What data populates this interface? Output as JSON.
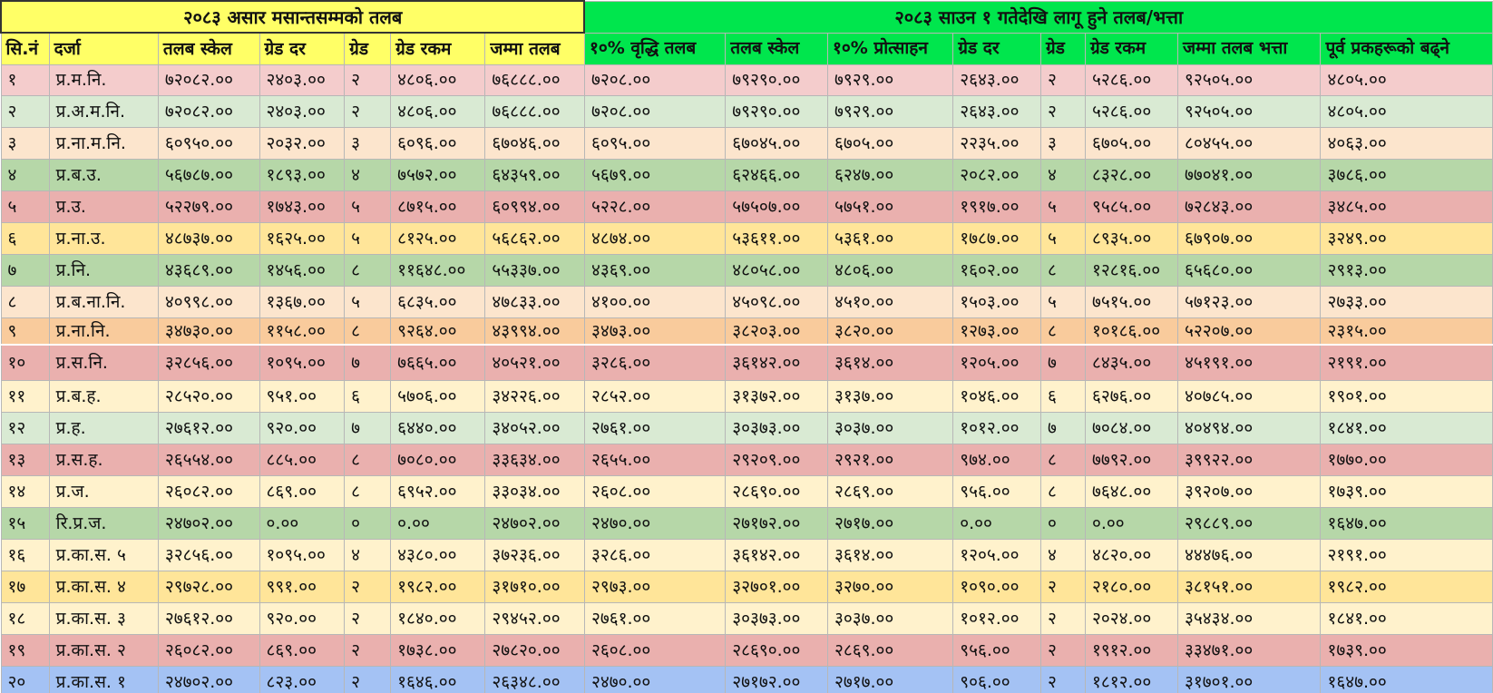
{
  "colors": {
    "yellow": "#ffff66",
    "green": "#00e64d",
    "pink": "#f4cccc",
    "light_green": "#d9ead3",
    "peach": "#fce5cd",
    "mid_green": "#b6d7a8",
    "rose": "#eab0ae",
    "gold": "#ffe599",
    "orange": "#f9cb9c",
    "cream": "#fff2cc",
    "blue": "#a4c2f4"
  },
  "header": {
    "left_title": "२०८३ असार मसान्तसम्मको तलब",
    "right_title": "२०८३ साउन १ गतेदेखि लागू हुने तलब/भत्ता"
  },
  "columns": [
    "सि.नं",
    "दर्जा",
    "तलब स्केल",
    "ग्रेड दर",
    "ग्रेड",
    "ग्रेड रकम",
    "जम्मा तलब",
    "१०% वृद्धि तलब",
    "तलब स्केल",
    "१०% प्रोत्साहन",
    "ग्रेड दर",
    "ग्रेड",
    "ग्रेड रकम",
    "जम्मा तलब भत्ता",
    "पूर्व प्रकहरूको बढ्ने"
  ],
  "rows": [
    {
      "color": "pink",
      "cells": [
        "१",
        "प्र.म.नि.",
        "७२०८२.००",
        "२४०३.००",
        "२",
        "४८०६.००",
        "७६८८८.००",
        "७२०८.००",
        "७९२९०.००",
        "७९२९.००",
        "२६४३.००",
        "२",
        "५२८६.००",
        "९२५०५.००",
        "४८०५.००"
      ]
    },
    {
      "color": "light_green",
      "cells": [
        "२",
        "प्र.अ.म.नि.",
        "७२०८२.००",
        "२४०३.००",
        "२",
        "४८०६.००",
        "७६८८८.००",
        "७२०८.००",
        "७९२९०.००",
        "७९२९.००",
        "२६४३.००",
        "२",
        "५२८६.००",
        "९२५०५.००",
        "४८०५.००"
      ]
    },
    {
      "color": "peach",
      "cells": [
        "३",
        "प्र.ना.म.नि.",
        "६०९५०.००",
        "२०३२.००",
        "३",
        "६०९६.००",
        "६७०४६.००",
        "६०९५.००",
        "६७०४५.००",
        "६७०५.००",
        "२२३५.००",
        "३",
        "६७०५.००",
        "८०४५५.००",
        "४०६३.००"
      ]
    },
    {
      "color": "mid_green",
      "cells": [
        "४",
        "प्र.ब.उ.",
        "५६७८७.००",
        "१८९३.००",
        "४",
        "७५७२.००",
        "६४३५९.००",
        "५६७९.००",
        "६२४६६.००",
        "६२४७.००",
        "२०८२.००",
        "४",
        "८३२८.००",
        "७७०४१.००",
        "३७८६.००"
      ]
    },
    {
      "color": "rose",
      "cells": [
        "५",
        "प्र.उ.",
        "५२२७९.००",
        "१७४३.००",
        "५",
        "८७१५.००",
        "६०९९४.००",
        "५२२८.००",
        "५७५०७.००",
        "५७५१.००",
        "१९१७.००",
        "५",
        "९५८५.००",
        "७२८४३.००",
        "३४८५.००"
      ]
    },
    {
      "color": "gold",
      "cells": [
        "६",
        "प्र.ना.उ.",
        "४८७३७.००",
        "१६२५.००",
        "५",
        "८१२५.००",
        "५६८६२.००",
        "४८७४.००",
        "५३६११.००",
        "५३६१.००",
        "१७८७.००",
        "५",
        "८९३५.००",
        "६७९०७.००",
        "३२४९.००"
      ]
    },
    {
      "color": "mid_green",
      "cells": [
        "७",
        "प्र.नि.",
        "४३६८९.००",
        "१४५६.००",
        "८",
        "११६४८.००",
        "५५३३७.००",
        "४३६९.००",
        "४८०५८.००",
        "४८०६.००",
        "१६०२.००",
        "८",
        "१२८१६.००",
        "६५६८०.००",
        "२९१३.००"
      ]
    },
    {
      "color": "peach",
      "cells": [
        "८",
        "प्र.ब.ना.नि.",
        "४०९९८.००",
        "१३६७.००",
        "५",
        "६८३५.००",
        "४७८३३.००",
        "४१००.००",
        "४५०९८.००",
        "४५१०.००",
        "१५०३.००",
        "५",
        "७५१५.००",
        "५७१२३.००",
        "२७३३.००"
      ]
    },
    {
      "color": "orange",
      "cells": [
        "९",
        "प्र.ना.नि.",
        "३४७३०.००",
        "११५८.००",
        "८",
        "९२६४.००",
        "४३९९४.००",
        "३४७३.००",
        "३८२०३.००",
        "३८२०.००",
        "१२७३.००",
        "८",
        "१०१८६.००",
        "५२२०७.००",
        "२३१५.००"
      ]
    },
    {
      "color": "rose",
      "cells": [
        "१०",
        "प्र.स.नि.",
        "३२८५६.००",
        "१०९५.००",
        "७",
        "७६६५.००",
        "४०५२१.००",
        "३२८६.००",
        "३६१४२.००",
        "३६१४.००",
        "१२०५.००",
        "७",
        "८४३५.००",
        "४५१९१.००",
        "२१९१.००"
      ]
    },
    {
      "color": "cream",
      "cells": [
        "११",
        "प्र.ब.ह.",
        "२८५२०.००",
        "९५१.००",
        "६",
        "५७०६.००",
        "३४२२६.००",
        "२८५२.००",
        "३१३७२.००",
        "३१३७.००",
        "१०४६.००",
        "६",
        "६२७६.००",
        "४०७८५.००",
        "१९०१.००"
      ]
    },
    {
      "color": "light_green",
      "cells": [
        "१२",
        "प्र.ह.",
        "२७६१२.००",
        "९२०.००",
        "७",
        "६४४०.००",
        "३४०५२.००",
        "२७६१.००",
        "३०३७३.००",
        "३०३७.००",
        "१०१२.००",
        "७",
        "७०८४.००",
        "४०४९४.००",
        "१८४१.००"
      ]
    },
    {
      "color": "rose",
      "cells": [
        "१३",
        "प्र.स.ह.",
        "२६५५४.००",
        "८८५.००",
        "८",
        "७०८०.००",
        "३३६३४.००",
        "२६५५.००",
        "२९२०९.००",
        "२९२१.००",
        "९७४.००",
        "८",
        "७७९२.००",
        "३९९२२.००",
        "१७७०.००"
      ]
    },
    {
      "color": "cream",
      "cells": [
        "१४",
        "प्र.ज.",
        "२६०८२.००",
        "८६९.००",
        "८",
        "६९५२.००",
        "३३०३४.००",
        "२६०८.००",
        "२८६९०.००",
        "२८६९.००",
        "९५६.००",
        "८",
        "७६४८.००",
        "३९२०७.००",
        "१७३९.००"
      ]
    },
    {
      "color": "mid_green",
      "cells": [
        "१५",
        "रि.प्र.ज.",
        "२४७०२.००",
        "०.००",
        "०",
        "०.००",
        "२४७०२.००",
        "२४७०.००",
        "२७१७२.००",
        "२७१७.००",
        "०.००",
        "०",
        "०.००",
        "२९८८९.००",
        "१६४७.००"
      ]
    },
    {
      "color": "cream",
      "cells": [
        "१६",
        "प्र.का.स. ५",
        "३२८५६.००",
        "१०९५.००",
        "४",
        "४३८०.००",
        "३७२३६.००",
        "३२८६.००",
        "३६१४२.००",
        "३६१४.००",
        "१२०५.००",
        "४",
        "४८२०.००",
        "४४४७६.००",
        "२१९१.००"
      ]
    },
    {
      "color": "gold",
      "cells": [
        "१७",
        "प्र.का.स. ४",
        "२९७२८.००",
        "९९१.००",
        "२",
        "१९८२.००",
        "३१७१०.००",
        "२९७३.००",
        "३२७०१.००",
        "३२७०.००",
        "१०९०.००",
        "२",
        "२१८०.००",
        "३८१५१.००",
        "१९८२.००"
      ]
    },
    {
      "color": "cream",
      "cells": [
        "१८",
        "प्र.का.स. ३",
        "२७६१२.००",
        "९२०.००",
        "२",
        "१८४०.००",
        "२९४५२.००",
        "२७६१.००",
        "३०३७३.००",
        "३०३७.००",
        "१०१२.००",
        "२",
        "२०२४.००",
        "३५४३४.००",
        "१८४१.००"
      ]
    },
    {
      "color": "rose",
      "cells": [
        "१९",
        "प्र.का.स. २",
        "२६०८२.००",
        "८६९.००",
        "२",
        "१७३८.००",
        "२७८२०.००",
        "२६०८.००",
        "२८६९०.००",
        "२८६९.००",
        "९५६.००",
        "२",
        "१९१२.००",
        "३३४७१.००",
        "१७३९.००"
      ]
    },
    {
      "color": "blue",
      "cells": [
        "२०",
        "प्र.का.स. १",
        "२४७०२.००",
        "८२३.००",
        "२",
        "१६४६.००",
        "२६३४८.००",
        "२४७०.००",
        "२७१७२.००",
        "२७१७.००",
        "९०६.००",
        "२",
        "१८१२.००",
        "३१७०१.००",
        "१६४७.००"
      ]
    }
  ]
}
